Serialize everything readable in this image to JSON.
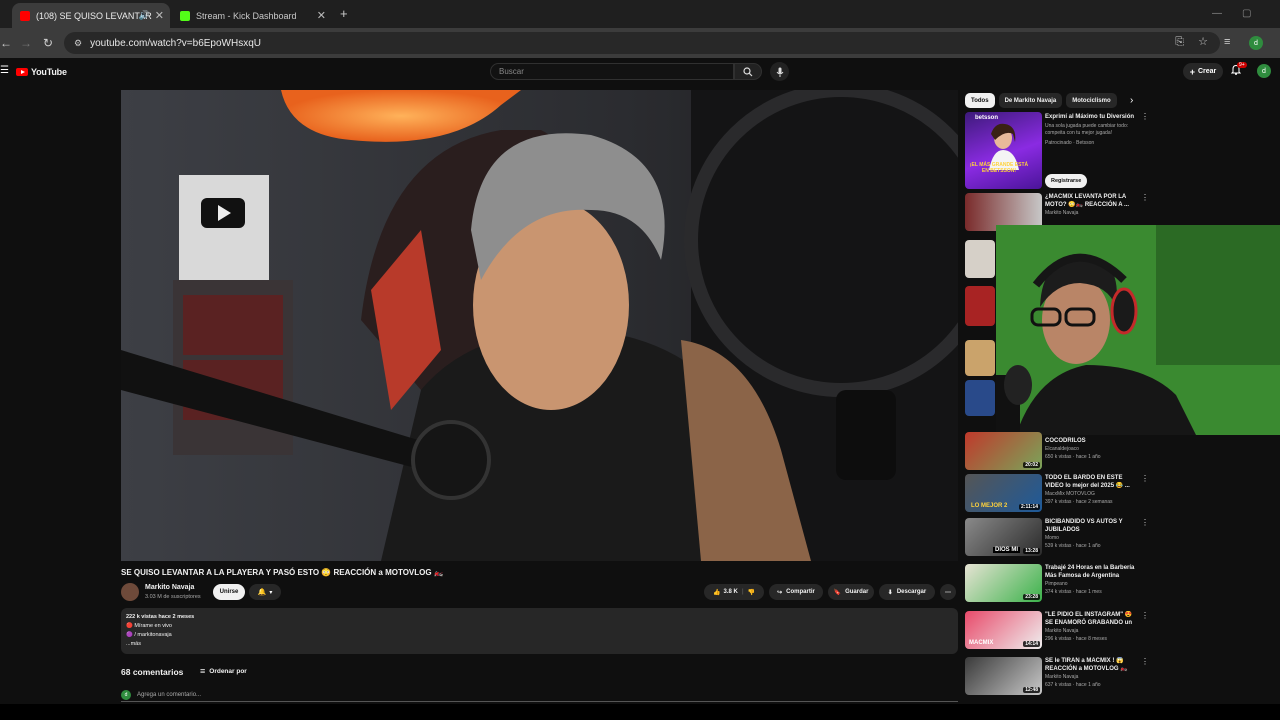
{
  "browser": {
    "tabs": [
      {
        "label": "(108) SE QUISO LEVANTAR",
        "active": true
      },
      {
        "label": "Stream - Kick Dashboard",
        "active": false
      }
    ],
    "new_tab": "+",
    "url": "youtube.com/watch?v=b6EpoWHsxqU"
  },
  "youtube": {
    "logo": "YouTube",
    "search_placeholder": "Buscar",
    "create_label": "Crear",
    "notif_badge": "9+",
    "avatar_letter": "d"
  },
  "video": {
    "title": "SE QUISO LEVANTAR A LA PLAYERA Y PASÓ ESTO 😳 REACCIÓN a MOTOVLOG 🏍️",
    "channel": "Markito Navaja",
    "subs": "3.03 M de suscriptores",
    "join": "Unirse",
    "likes": "3.8 K",
    "share": "Compartir",
    "save": "Guardar",
    "download": "Descargar",
    "desc_meta": "222 k vistas  hace 2 meses",
    "desc_line1": "🔴 Mírame en vivo",
    "desc_line2": "🟣 / markitonavaja",
    "desc_more": "...más",
    "comments_count": "68 comentarios",
    "sort_label": "Ordenar por",
    "comment_placeholder": "Agrega un comentario..."
  },
  "sidebar": {
    "chips": [
      "Todos",
      "De Markito Navaja",
      "Motociclismo"
    ],
    "ad": {
      "brand": "betsson",
      "promo": "¡EL MÁS GRANDE ESTÁ EN BETSSON!",
      "title": "Exprimí al Máximo tu Diversión",
      "desc": "Una sola jugada puede cambiar todo: compeita con tu mejor jugada!",
      "sponsor": "Patrocinado · Betsson",
      "button": "Registrarse"
    },
    "cards": [
      {
        "title": "¿MACMIX LEVANTA POR LA MOTO? 😳🏍️ REACCIÓN A ...",
        "channel": "Markito Navaja",
        "stats": "",
        "duration": ""
      },
      {
        "title": "COCODRILOS",
        "channel": "Elcanaldejoaco",
        "stats": "650 k vistas · hace 1 año",
        "duration": "20:02"
      },
      {
        "title": "TODO EL BARDO EN ÉSTE VIDEO  lo mejor del 2025 😂 ...",
        "channel": "MacxMix MOTOVLOG",
        "stats": "397 k vistas · hace 2 semanas",
        "duration": "2:11:14"
      },
      {
        "title": "BICIBANDIDO VS AUTOS Y JUBILADOS",
        "channel": "Momo",
        "stats": "539 k vistas · hace 1 año",
        "duration": "13:28"
      },
      {
        "title": "Trabajé 24 Horas en la Barbería Más Famosa de Argentina",
        "channel": "Pimpeano",
        "stats": "374 k vistas · hace 1 mes",
        "duration": "23:28"
      },
      {
        "title": "\"LE PIDIÓ EL INSTAGRAM\" 😍 SE ENAMORÓ GRABANDO un ...",
        "channel": "Markito Navaja",
        "stats": "296 k vistas · hace 8 meses",
        "duration": "14:14"
      },
      {
        "title": "SE le TIRAN a MACMIX ! 😱 REACCIÓN a MOTOVLOG 🏍️",
        "channel": "Markito Navaja",
        "stats": "637 k vistas · hace 1 año",
        "duration": "12:48"
      }
    ]
  }
}
